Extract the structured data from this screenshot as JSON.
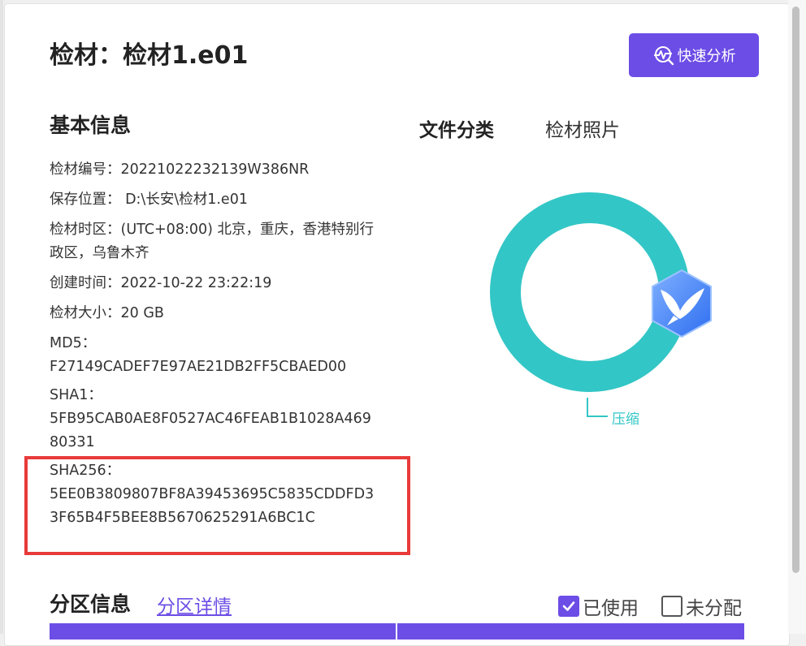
{
  "header": {
    "title": "检材：检材1.e01",
    "quick_analysis_label": "快速分析"
  },
  "basic_info": {
    "section_title": "基本信息",
    "rows": [
      {
        "label": "检材编号：",
        "value": "20221022232139W386NR"
      },
      {
        "label": "保存位置：",
        "value": " D:\\长安\\检材1.e01"
      },
      {
        "label": "检材时区：",
        "value": "(UTC+08:00) 北京，重庆，香港特别行政区，乌鲁木齐"
      },
      {
        "label": "创建时间：",
        "value": "2022-10-22 23:22:19"
      },
      {
        "label": "检材大小：",
        "value": "20 GB"
      }
    ],
    "hashes": [
      {
        "label": "MD5：",
        "value": "F27149CADEF7E97AE21DB2FF5CBAED00"
      },
      {
        "label": "SHA1：",
        "value": "5FB95CAB0AE8F0527AC46FEAB1B1028A46980331"
      },
      {
        "label": "SHA256：",
        "value": "5EE0B3809807BF8A39453695C5835CDDFD33F65B4F5BEE8B5670625291A6BC1C"
      }
    ]
  },
  "file_classification": {
    "tab_category": "文件分类",
    "tab_photos": "检材照片",
    "chart_legend_label": "压缩",
    "ring_color": "#33c6c6"
  },
  "partition": {
    "title": "分区信息",
    "detail_link": "分区详情",
    "legend_used": "已使用",
    "legend_unallocated": "未分配",
    "used_checked": true,
    "unallocated_checked": false,
    "bar_color": "#6c4de6"
  },
  "colors": {
    "accent": "#6c4de6",
    "highlight_border": "#e83a3a",
    "chart_teal": "#33c6c6"
  }
}
